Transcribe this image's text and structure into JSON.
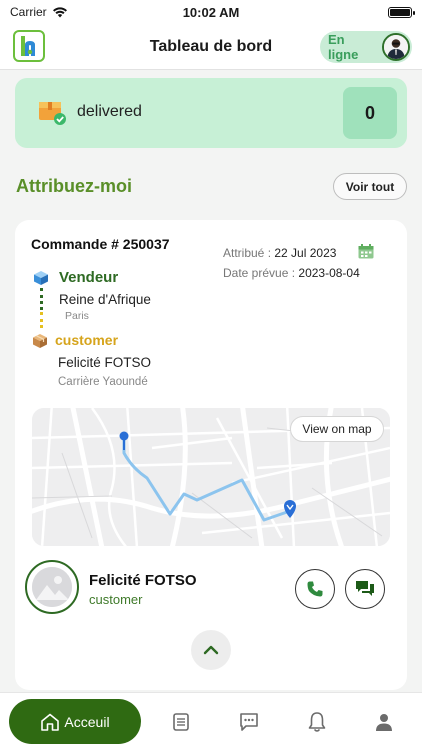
{
  "status_bar": {
    "carrier": "Carrier",
    "time": "10:02 AM"
  },
  "header": {
    "title": "Tableau de bord",
    "online_status": "En ligne"
  },
  "stats": {
    "delivered_label": "delivered",
    "delivered_count": "0"
  },
  "section": {
    "title": "Attribuez-moi",
    "see_all": "Voir tout"
  },
  "order": {
    "number": "Commande # 250037",
    "assigned_label": "Attribué :",
    "assigned_date": "22 Jul 2023",
    "due_label": "Date prévue :",
    "due_date": "2023-08-04",
    "vendor_title": "Vendeur",
    "vendor_name": "Reine d'Afrique",
    "vendor_city": "Paris",
    "customer_title": "customer",
    "customer_name": "Felicité FOTSO",
    "customer_address": "Carrière Yaoundé",
    "view_on_map": "View on map"
  },
  "contact": {
    "name": "Felicité FOTSO",
    "role": "customer"
  },
  "tabs": {
    "home": "Acceuil",
    "orders_icon": "list-icon",
    "messages_icon": "chat-icon",
    "notifications_icon": "bell-icon",
    "profile_icon": "user-icon"
  },
  "colors": {
    "brand_green": "#2f6a12",
    "section_green": "#5a8f29",
    "delivered_bg": "#c7f0d6",
    "customer_yellow": "#d6a41c",
    "route_blue": "#8cc4ee"
  }
}
